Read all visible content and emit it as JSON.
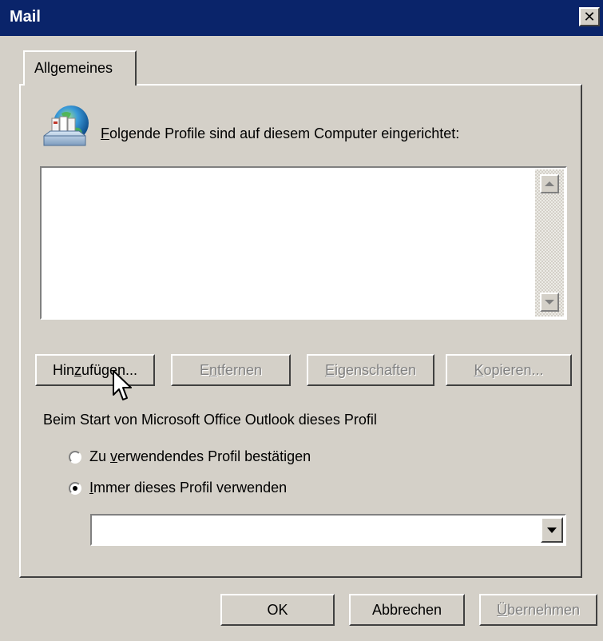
{
  "window": {
    "title": "Mail",
    "close_glyph": "✕"
  },
  "tabs": [
    {
      "label": "Allgemeines"
    }
  ],
  "profiles": {
    "label_prefix": "F",
    "label_rest": "olgende Profile sind auf diesem Computer eingerichtet:",
    "items": [],
    "icon": "mail-profiles-icon"
  },
  "list_buttons": {
    "add": {
      "pre": "Hin",
      "key": "z",
      "post": "ufügen...",
      "enabled": true
    },
    "remove": {
      "pre": "E",
      "key": "n",
      "post": "tfernen",
      "enabled": false
    },
    "properties": {
      "pre": "",
      "key": "E",
      "post": "igenschaften",
      "enabled": false
    },
    "copy": {
      "pre": "",
      "key": "K",
      "post": "opieren...",
      "enabled": false
    }
  },
  "startup": {
    "label": "Beim Start von Microsoft Office Outlook dieses Profil",
    "options": [
      {
        "pre": "Zu ",
        "key": "v",
        "post": "erwendendes Profil bestätigen",
        "selected": false
      },
      {
        "pre": "",
        "key": "I",
        "post": "mmer dieses Profil verwenden",
        "selected": true
      }
    ],
    "profile_select_value": ""
  },
  "footer": {
    "ok": "OK",
    "cancel": "Abbrechen",
    "apply_key": "Ü",
    "apply_rest": "bernehmen"
  },
  "colors": {
    "titlebar": "#0a246a",
    "face": "#d4d0c8"
  }
}
